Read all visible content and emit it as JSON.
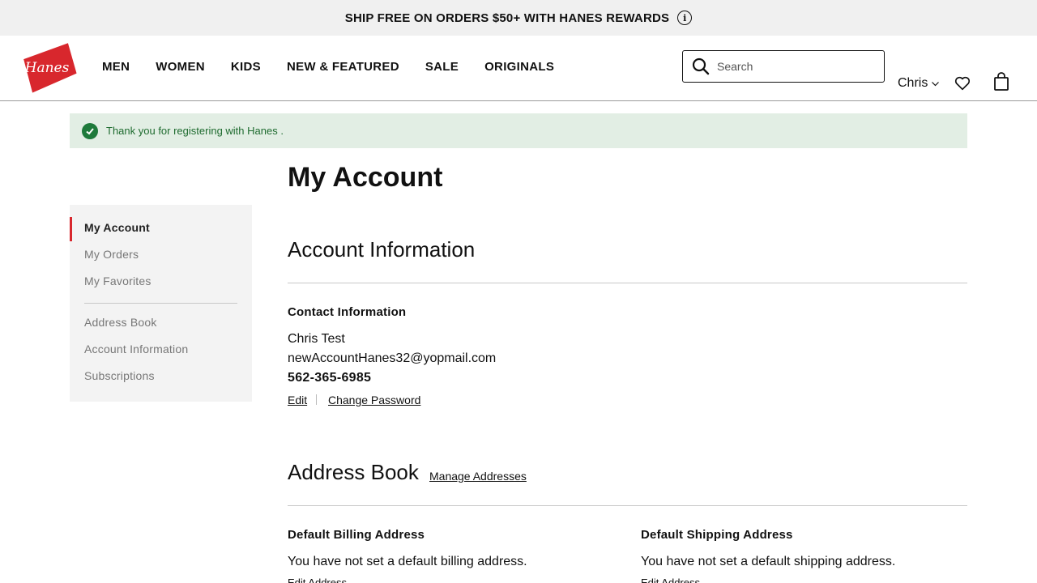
{
  "promo": {
    "text": "SHIP FREE ON ORDERS $50+ WITH HANES REWARDS"
  },
  "brand": {
    "logo_text": "Hanes",
    "color": "#d8272d"
  },
  "nav": {
    "items": [
      "MEN",
      "WOMEN",
      "KIDS",
      "NEW & FEATURED",
      "SALE",
      "ORIGINALS"
    ]
  },
  "search": {
    "placeholder": "Search"
  },
  "user": {
    "name": "Chris"
  },
  "notice": {
    "text": "Thank you for registering with Hanes ."
  },
  "sidebar": {
    "items": [
      {
        "label": "My Account"
      },
      {
        "label": "My Orders"
      },
      {
        "label": "My Favorites"
      },
      {
        "label": "Address Book"
      },
      {
        "label": "Account Information"
      },
      {
        "label": "Subscriptions"
      }
    ]
  },
  "page": {
    "title": "My Account"
  },
  "account_info": {
    "title": "Account Information",
    "contact_heading": "Contact Information",
    "name": "Chris Test",
    "email": "newAccountHanes32@yopmail.com",
    "phone": "562-365-6985",
    "edit_label": "Edit",
    "change_password_label": "Change Password"
  },
  "address_book": {
    "title": "Address Book",
    "manage_label": "Manage Addresses",
    "billing": {
      "heading": "Default Billing Address",
      "text": "You have not set a default billing address.",
      "edit_label": "Edit Address"
    },
    "shipping": {
      "heading": "Default Shipping Address",
      "text": "You have not set a default shipping address.",
      "edit_label": "Edit Address"
    }
  }
}
